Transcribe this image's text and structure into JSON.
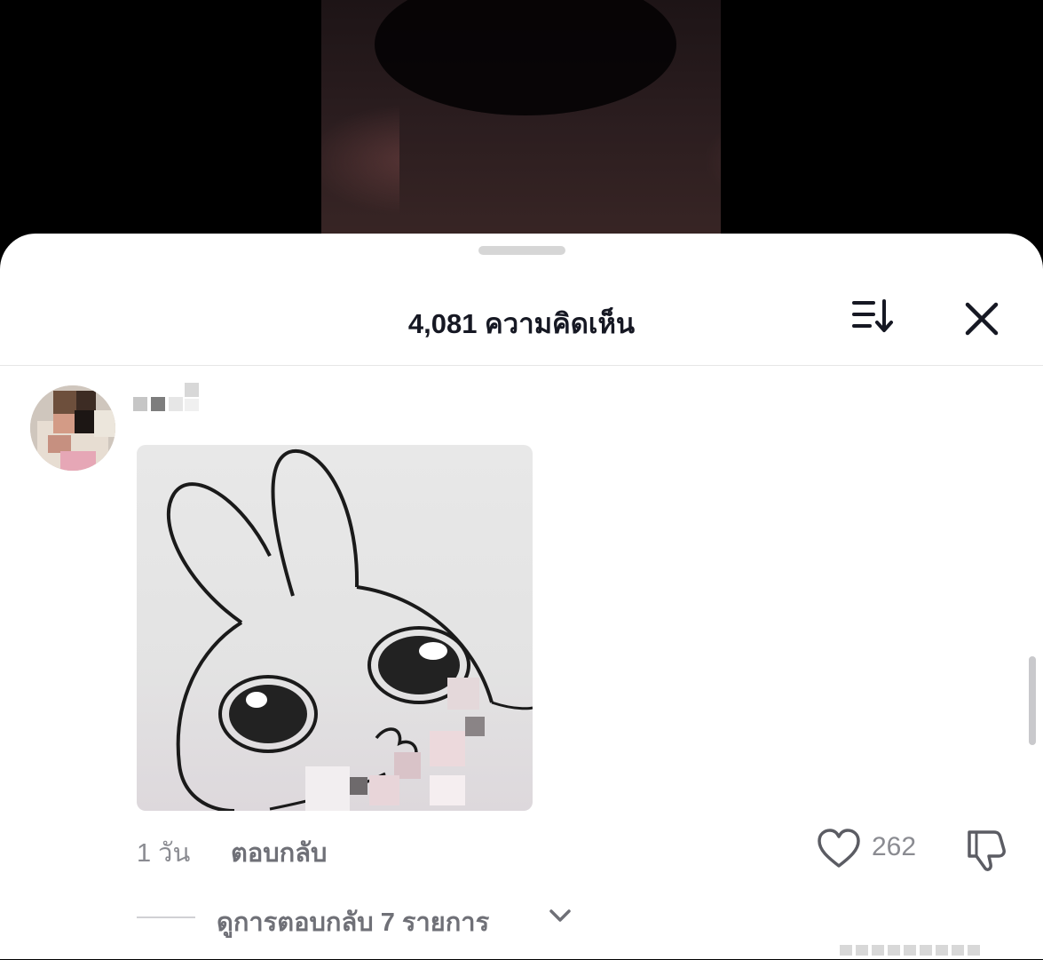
{
  "header": {
    "comment_count_title": "4,081 ความคิดเห็น",
    "sort_icon": "sort-descending-icon",
    "close_icon": "close-icon"
  },
  "comment": {
    "avatar_icon": "user-avatar",
    "username_state": "pixelated",
    "attachment": "rabbit-sticker",
    "time": "1 วัน",
    "reply_label": "ตอบกลับ",
    "like_count": "262",
    "like_icon": "heart-icon",
    "dislike_icon": "thumbs-down-icon"
  },
  "replies": {
    "view_label": "ดูการตอบกลับ 7 รายการ",
    "chevron_icon": "chevron-down-icon"
  },
  "colors": {
    "sheet_bg": "#ffffff",
    "title_text": "#161823",
    "secondary_text": "#8a8b91",
    "action_text": "#6f7077"
  }
}
